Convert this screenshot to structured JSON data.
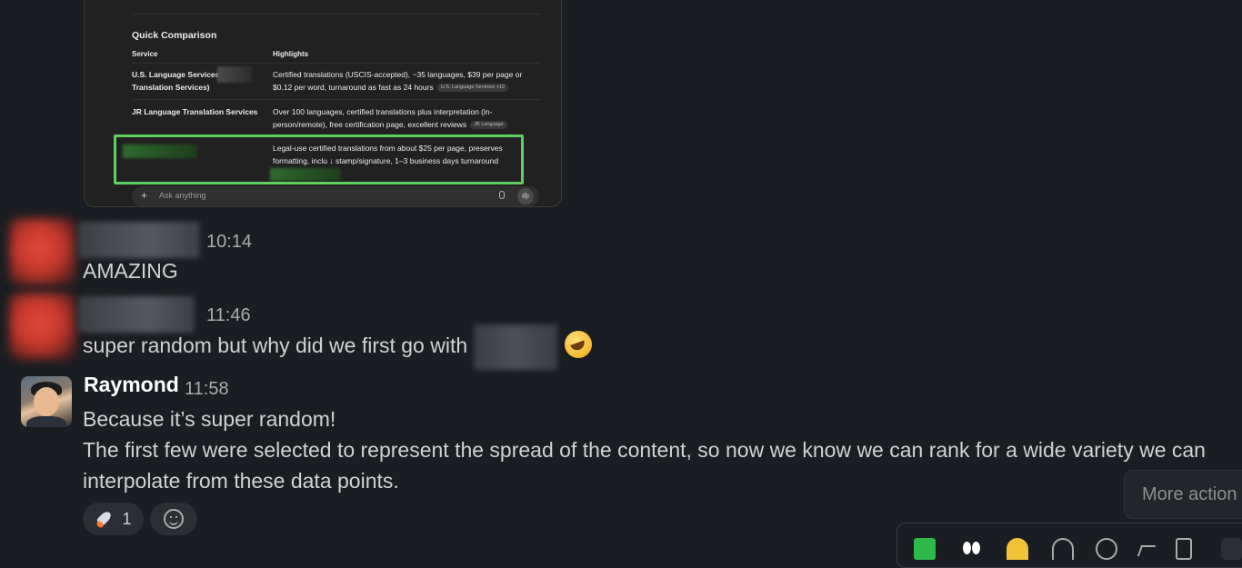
{
  "screenshot": {
    "section_title": "Quick Comparison",
    "col_service": "Service",
    "col_highlights": "Highlights",
    "row1_service_a": "U.S. Language Services",
    "row1_service_b": "Translation Services)",
    "row1_hl_a": "Certified translations (USCIS-accepted), ~35 languages, $39 per page or",
    "row1_hl_b": "$0.12 per word, turnaround as fast as 24 hours",
    "row1_pill": "U.S. Language Services +10",
    "row2_service": "JR Language Translation Services",
    "row2_hl_a": "Over 100 languages, certified translations plus interpretation (in-",
    "row2_hl_b": "person/remote), free certification page, excellent reviews",
    "row2_pill": "JR Language",
    "row3_hl_a": "Legal-use certified translations from about $25 per page, preserves",
    "row3_hl_b": "formatting, inclu ↓ stamp/signature, 1–3 business days turnaround",
    "ask_plus": "+",
    "ask_placeholder": "Ask anything",
    "voice_icon": "ıl|ı"
  },
  "messages": [
    {
      "time": "10:14",
      "text": "AMAZING"
    },
    {
      "time": "11:46",
      "text": "super random but why did we first go with"
    },
    {
      "author": "Raymond",
      "time": "11:58",
      "lines": [
        "Because it’s super random!",
        "The first few were selected to represent the spread of the content, so now we know we can rank for a wide variety we can",
        "interpolate from these data points."
      ]
    }
  ],
  "reactions": {
    "rocket_count": "1"
  },
  "more_actions_label": "More action",
  "icons": [
    "rocket-icon",
    "add-reaction-icon",
    "rofl-emoji-icon",
    "check-icon",
    "eyes-icon",
    "raised-hands-icon",
    "reply-icon",
    "thread-icon",
    "share-icon",
    "bookmark-icon",
    "more-icon"
  ],
  "colors": {
    "background": "#1a1d21",
    "highlight_green": "#5fcf5f",
    "text": "#d1d2d3",
    "timestamp": "#ababad"
  }
}
